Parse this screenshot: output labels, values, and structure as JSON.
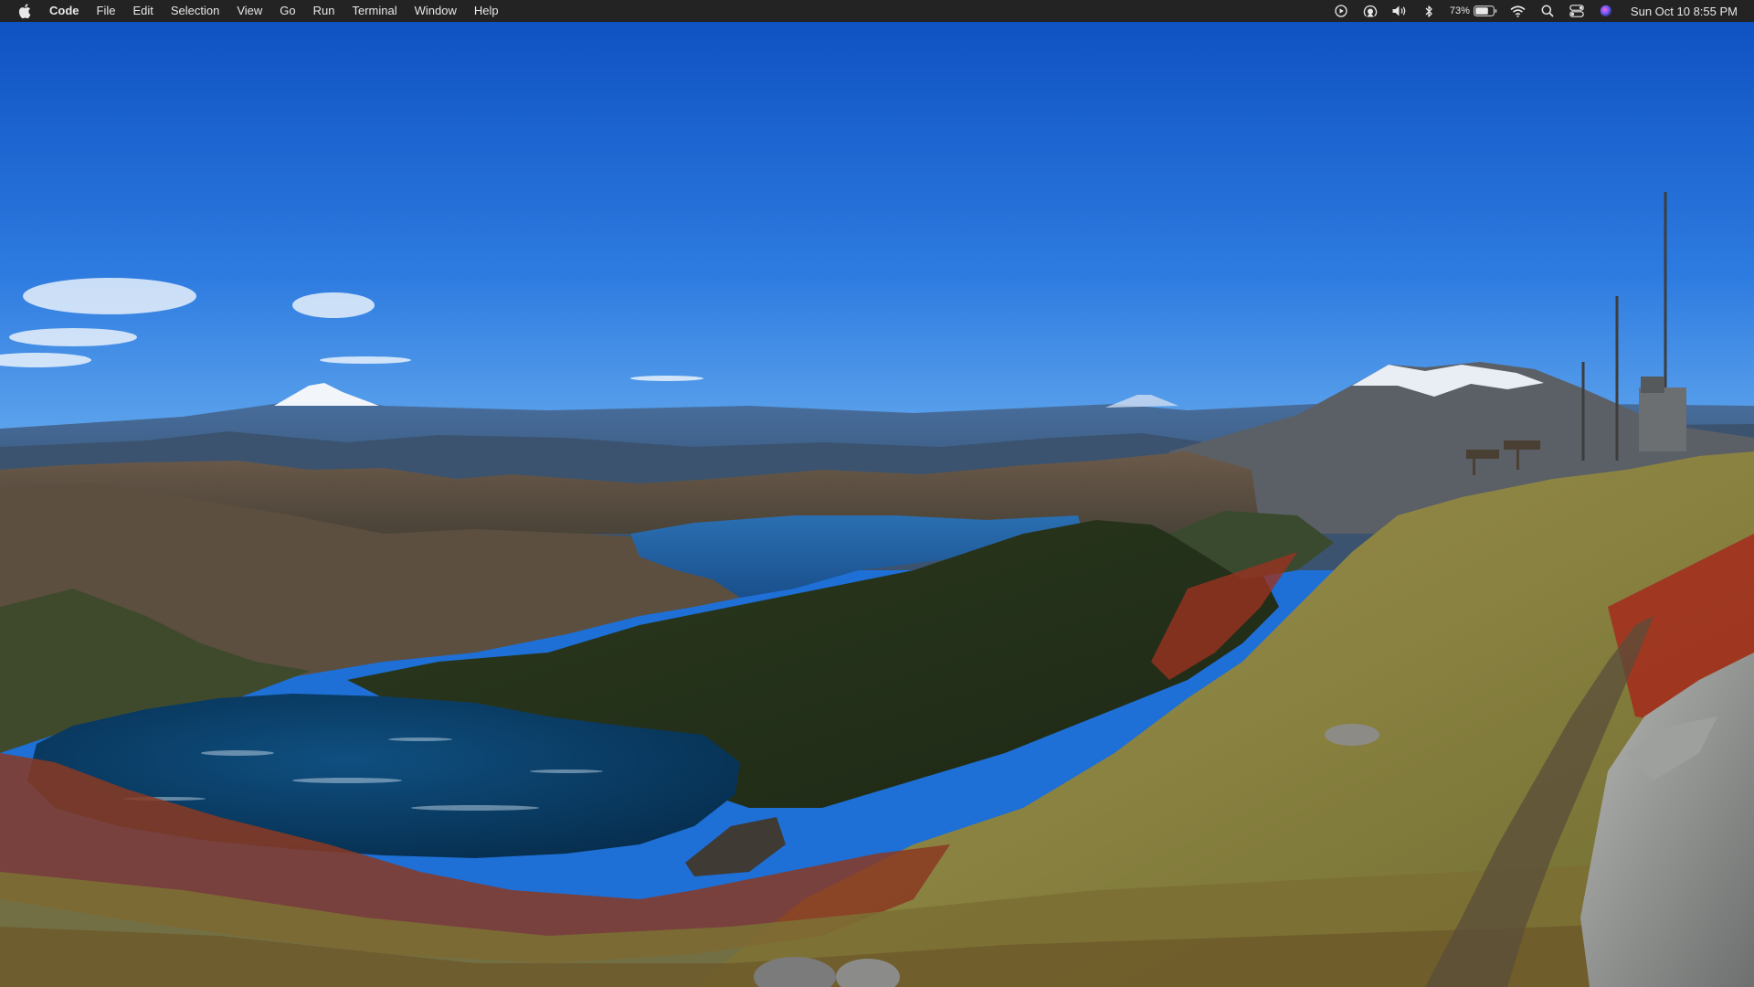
{
  "menubar": {
    "apple_icon": "apple-logo-icon",
    "items": [
      {
        "label": "Code",
        "bold": true
      },
      {
        "label": "File"
      },
      {
        "label": "Edit"
      },
      {
        "label": "Selection"
      },
      {
        "label": "View"
      },
      {
        "label": "Go"
      },
      {
        "label": "Run"
      },
      {
        "label": "Terminal"
      },
      {
        "label": "Window"
      },
      {
        "label": "Help"
      }
    ],
    "status": {
      "icons": [
        "play-circle-icon",
        "airplay-audio-icon",
        "volume-icon",
        "bluetooth-icon"
      ],
      "battery_percent": "73%",
      "battery_level": 0.73,
      "right_icons": [
        "wifi-icon",
        "spotlight-search-icon",
        "control-center-icon",
        "siri-icon"
      ],
      "clock": "Sun Oct 10  8:55 PM"
    }
  },
  "wallpaper": {
    "description_icon": "mountain-landscape-wallpaper",
    "colors": {
      "sky_top": "#0f52c2",
      "sky_bottom": "#4e97ea",
      "lake": "#0b3f6a",
      "grass": "#8c8a3e",
      "foliage_red": "#a8321f"
    }
  }
}
